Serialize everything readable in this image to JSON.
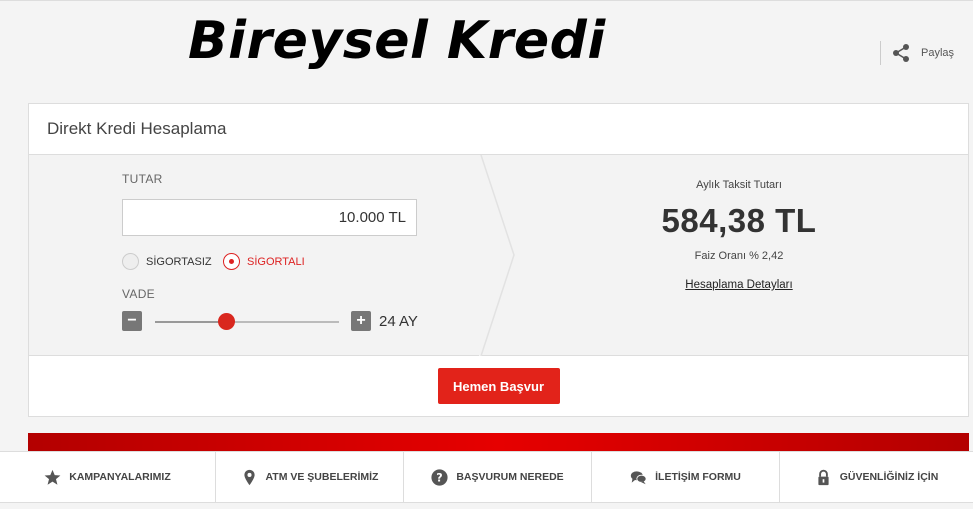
{
  "header": {
    "title": "Bireysel Kredi",
    "share_label": "Paylaş"
  },
  "calculator": {
    "heading": "Direkt Kredi Hesaplama",
    "amount_label": "TUTAR",
    "amount_value": "10.000 TL",
    "insurance_options": [
      {
        "label": "SİGORTASIZ",
        "selected": false
      },
      {
        "label": "SİGORTALI",
        "selected": true
      }
    ],
    "term_label": "VADE",
    "term_text": "24 AY",
    "term_slider_fraction": 0.39,
    "minus_symbol": "−",
    "plus_symbol": "+"
  },
  "result": {
    "caption": "Aylık Taksit Tutarı",
    "amount": "584,38 TL",
    "rate": "Faiz Oranı % 2,42",
    "details_link": "Hesaplama Detayları"
  },
  "apply_button": "Hemen Başvur",
  "bottom_nav": [
    {
      "label": "KAMPANYALARIMIZ",
      "icon": "star-icon"
    },
    {
      "label": "ATM VE ŞUBELERİMİZ",
      "icon": "location-pin-icon"
    },
    {
      "label": "BAŞVURUM NEREDE",
      "icon": "question-icon"
    },
    {
      "label": "İLETİŞİM FORMU",
      "icon": "chat-icon"
    },
    {
      "label": "GÜVENLİĞİNİZ İÇİN",
      "icon": "lock-icon"
    }
  ],
  "colors": {
    "accent": "#e2231a",
    "band_dark": "#b30000",
    "band_light": "#e60000",
    "icon_gray": "#555555"
  }
}
